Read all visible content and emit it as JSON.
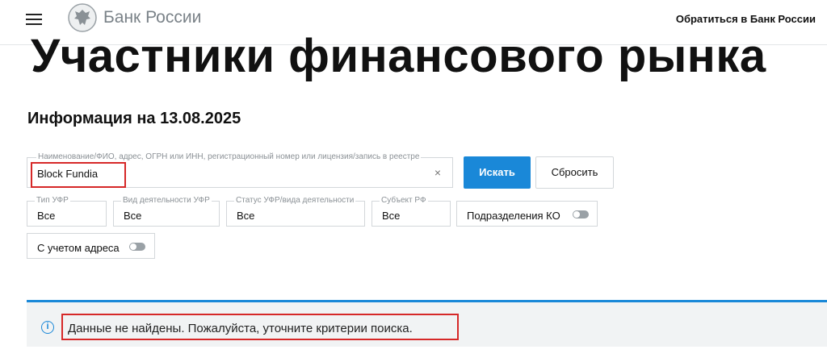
{
  "header": {
    "brand": "Банк России",
    "contact_link": "Обратиться в Банк России",
    "icons": {
      "menu": "hamburger-menu-icon",
      "logo": "bank-eagle-emblem-icon"
    }
  },
  "page": {
    "title": "Участники финансового рынка",
    "info_date": "Информация на 13.08.2025"
  },
  "search": {
    "label": "Наименование/ФИО, адрес, ОГРН или ИНН, регистрационный номер или лицензия/запись в реестре",
    "value": "Block Fundia",
    "clear_symbol": "×",
    "search_button": "Искать",
    "reset_button": "Сбросить"
  },
  "filters": {
    "ufr_type": {
      "label": "Тип УФР",
      "value": "Все"
    },
    "activity_type": {
      "label": "Вид деятельности УФР",
      "value": "Все"
    },
    "status": {
      "label": "Статус УФР/вида деятельности",
      "value": "Все"
    },
    "subject": {
      "label": "Субъект РФ",
      "value": "Все"
    },
    "ko_divisions": {
      "label": "Подразделения КО",
      "enabled": false
    },
    "with_address": {
      "label": "С учетом адреса",
      "enabled": false
    }
  },
  "notice": {
    "icon": "info-icon",
    "glyph": "i",
    "text": "Данные не найдены. Пожалуйста, уточните критерии поиска."
  },
  "colors": {
    "accent": "#1a88d8",
    "highlight": "#d62828",
    "notice_bg": "#f1f3f4"
  }
}
